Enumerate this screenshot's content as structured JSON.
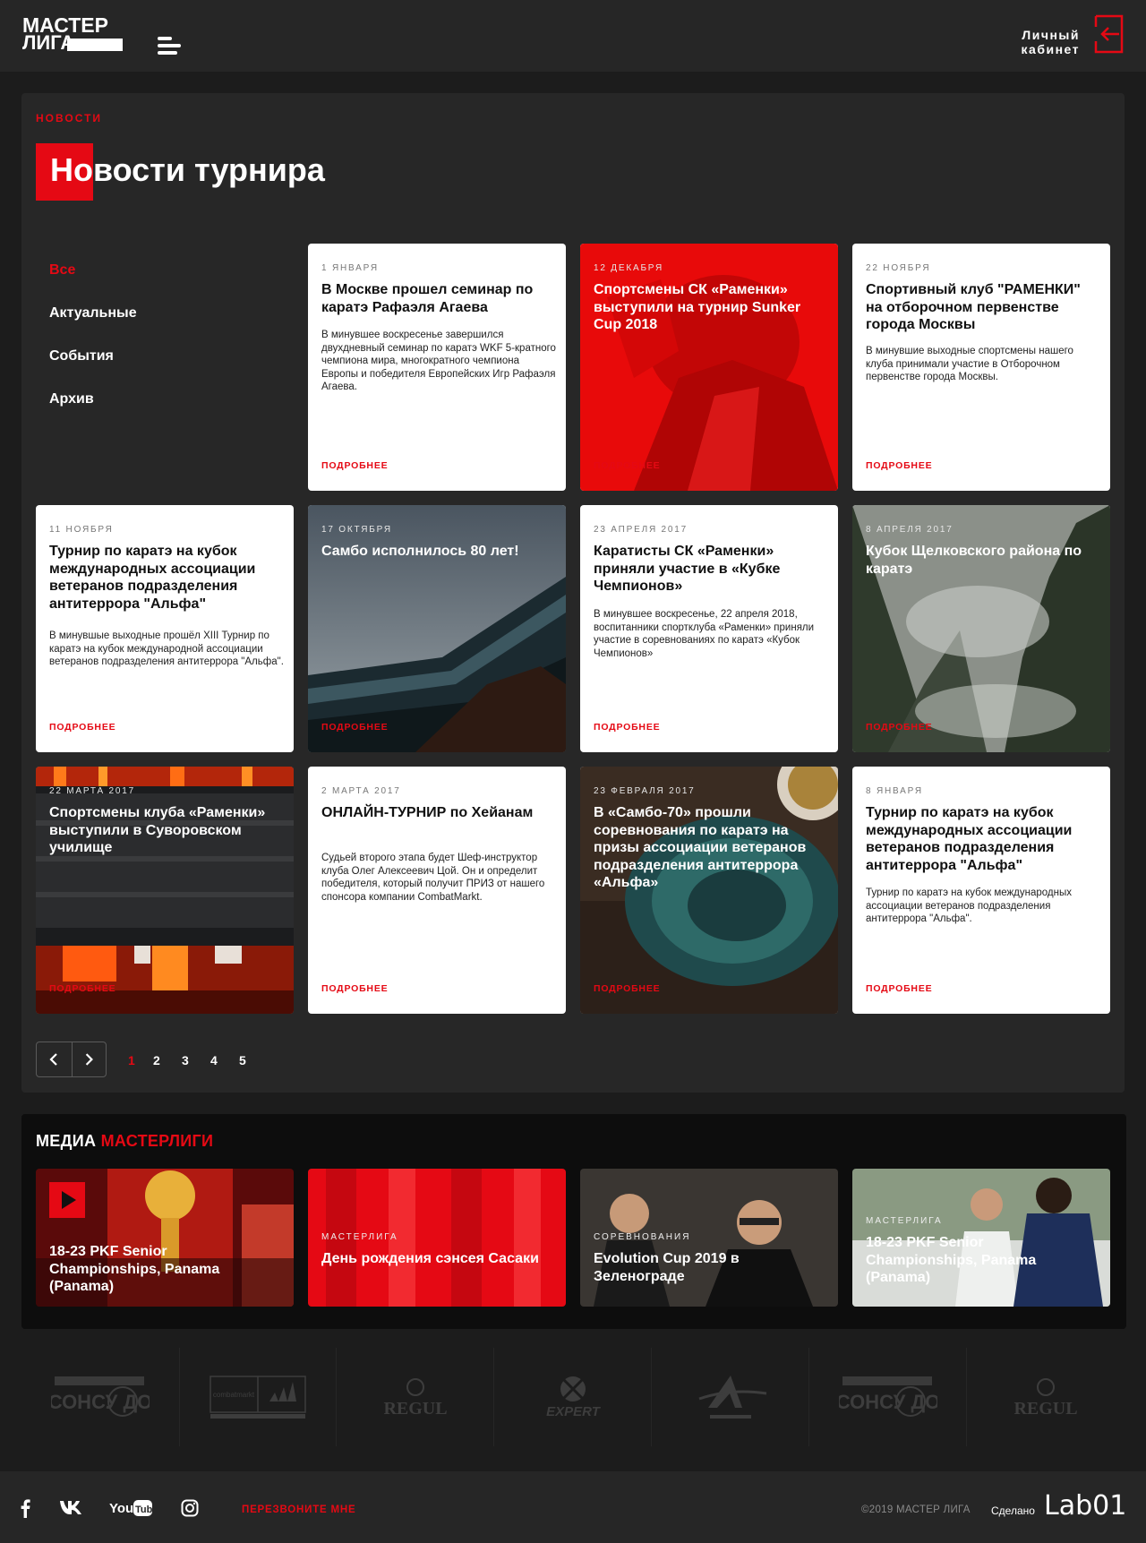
{
  "header": {
    "logo_line1": "МАСТЕР",
    "logo_line2": "ЛИГА",
    "cabinet_line1": "Личный",
    "cabinet_line2": "кабинет"
  },
  "news": {
    "breadcrumb": "НОВОСТИ",
    "title": "Новости турнира",
    "filters": [
      "Все",
      "Актуальные",
      "События",
      "Архив"
    ],
    "more_label": "ПОДРОБНЕЕ",
    "cards": [
      {
        "date": "1 ЯНВАРЯ",
        "title": "В Москве прошел семинар по каратэ Рафаэля Агаева",
        "text": "В минувшее воскресенье завершился двухдневный семинар по каратэ WKF 5-кратного чемпиона мира, многократного чемпиона Европы и победителя Европейских Игр Рафаэля Агаева."
      },
      {
        "date": "12 ДЕКАБРЯ",
        "title": "Спортсмены СК «Раменки» выступили на турнир Sunker Cup 2018",
        "text": ""
      },
      {
        "date": "22 НОЯБРЯ",
        "title": "Спортивный клуб \"РАМЕНКИ\" на отборочном первенстве города Москвы",
        "text": "В минувшие выходные спортсмены нашего клуба принимали участие в Отборочном первенстве города Москвы."
      },
      {
        "date": "11 НОЯБРЯ",
        "title": "Турнир по каратэ на кубок международных ассоциации ветеранов подразделения антитеррора \"Альфа\"",
        "text": "В минувшые выходные прошёл XIII Турнир по каратэ на кубок международной ассоциации ветеранов подразделения антитеррора \"Альфа\"."
      },
      {
        "date": "17 ОКТЯБРЯ",
        "title": "Самбо исполнилось 80 лет!",
        "text": ""
      },
      {
        "date": "23 АПРЕЛЯ 2017",
        "title": "Каратисты СК «Раменки» приняли участие в «Кубке Чемпионов»",
        "text": "В минувшее воскресенье, 22 апреля 2018, воспитанники спортклуба «Раменки» приняли участие в соревнованиях по каратэ «Кубок Чемпионов»"
      },
      {
        "date": "8 АПРЕЛЯ 2017",
        "title": "Кубок Щелковского района по каратэ",
        "text": ""
      },
      {
        "date": "22 МАРТА 2017",
        "title": "Спортсмены клуба «Раменки» выступили в Суворовском училище",
        "text": ""
      },
      {
        "date": "2 МАРТА 2017",
        "title": "ОНЛАЙН-ТУРНИР по Хейанам",
        "text": "Судьей второго этапа будет Шеф-инструктор клуба Олег Алексеевич Цой. Он и определит победителя, который получит ПРИЗ от нашего спонсора компании CombatMarkt."
      },
      {
        "date": "23 ФЕВРАЛЯ 2017",
        "title": "В «Самбо-70» прошли соревнования по каратэ на призы ассоциации ветеранов подразделения антитеррора «Альфа»",
        "text": ""
      },
      {
        "date": "8 ЯНВАРЯ",
        "title": "Турнир по каратэ на кубок международных ассоциации ветеранов подразделения антитеррора \"Альфа\"",
        "text": "Турнир по каратэ на кубок международных ассоциации ветеранов подразделения антитеррора \"Альфа\"."
      }
    ],
    "pages": [
      "1",
      "2",
      "3",
      "4",
      "5"
    ],
    "current_page": "1"
  },
  "media": {
    "title_white": "МЕДИА",
    "title_red": "МАСТЕРЛИГИ",
    "items": [
      {
        "category": "",
        "title": "18-23 PKF Senior Championships, Panama (Panama)"
      },
      {
        "category": "МАСТЕРЛИГА",
        "title": "День рождения сэнсея Сасаки"
      },
      {
        "category": "СОРЕВНОВАНИЯ",
        "title": "Evolution Cup 2019 в Зеленограде"
      },
      {
        "category": "МАСТЕРЛИГА",
        "title": "18-23 PKF Senior Championships, Panama (Panama)"
      }
    ]
  },
  "partners": [
    {
      "name": "ТРЕНИРОВОЧНЫЙ ЦЕНТР СОНСУ ДО",
      "icon": "sonsu-do-logo"
    },
    {
      "name": "combatmarkt adidas",
      "sub": "OFFICIAL MARTIAL ARTS & BOXING DISTRIBUTOR",
      "icon": "combatmarkt-adidas-logo"
    },
    {
      "name": "REGUL",
      "icon": "regul-logo"
    },
    {
      "name": "EXPERT",
      "icon": "expert-logo"
    },
    {
      "name": "ARMADA RUSSIA",
      "icon": "armada-logo"
    },
    {
      "name": "ТРЕНИРОВОЧНЫЙ ЦЕНТР СОНСУ ДО",
      "icon": "sonsu-do-logo"
    },
    {
      "name": "REGUL",
      "icon": "regul-logo"
    }
  ],
  "footer": {
    "social": [
      "f",
      "VK",
      "YouTube",
      "instagram"
    ],
    "callback": "ПЕРЕЗВОНИТЕ МНЕ",
    "copyright": "©2019 МАСТЕР ЛИГА",
    "made_by": "Сделано",
    "lab": "Lab01"
  },
  "colors": {
    "accent": "#e50914",
    "panel": "#272727",
    "background": "#1c1c1c"
  }
}
